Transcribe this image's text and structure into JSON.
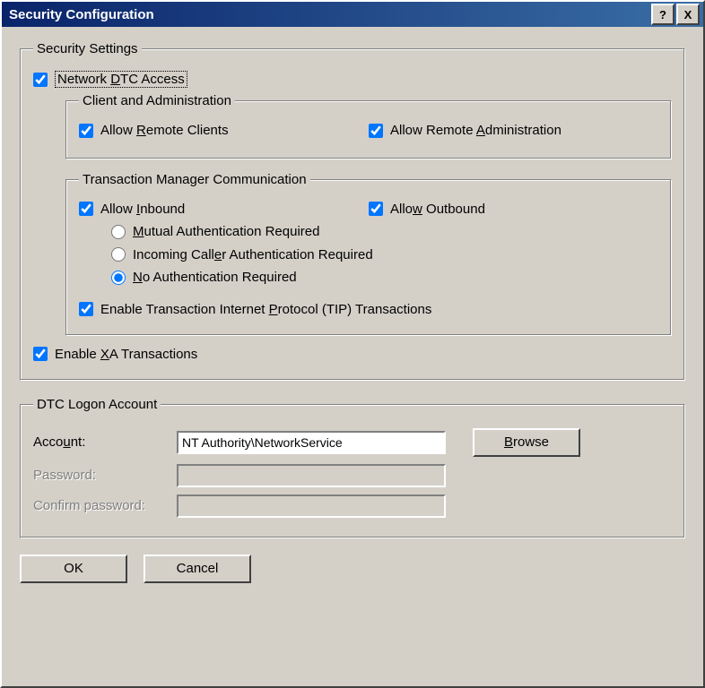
{
  "window": {
    "title": "Security Configuration",
    "help": "?",
    "close": "X"
  },
  "groups": {
    "security": "Security Settings",
    "client_admin": "Client and Administration",
    "tm_comm": "Transaction Manager Communication",
    "logon": "DTC Logon Account"
  },
  "checks": {
    "network_dtc": "Network DTC Access",
    "allow_remote_clients": "Allow Remote Clients",
    "allow_remote_admin": "Allow Remote Administration",
    "allow_inbound": "Allow Inbound",
    "allow_outbound": "Allow Outbound",
    "mutual_auth": "Mutual Authentication Required",
    "incoming_auth": "Incoming Caller Authentication Required",
    "no_auth": "No Authentication Required",
    "enable_tip": "Enable Transaction Internet Protocol (TIP) Transactions",
    "enable_xa": "Enable XA Transactions"
  },
  "account": {
    "account_label": "Account:",
    "account_value": "NT Authority\\NetworkService",
    "password_label": "Password:",
    "confirm_label": "Confirm password:",
    "browse": "Browse"
  },
  "buttons": {
    "ok": "OK",
    "cancel": "Cancel"
  }
}
